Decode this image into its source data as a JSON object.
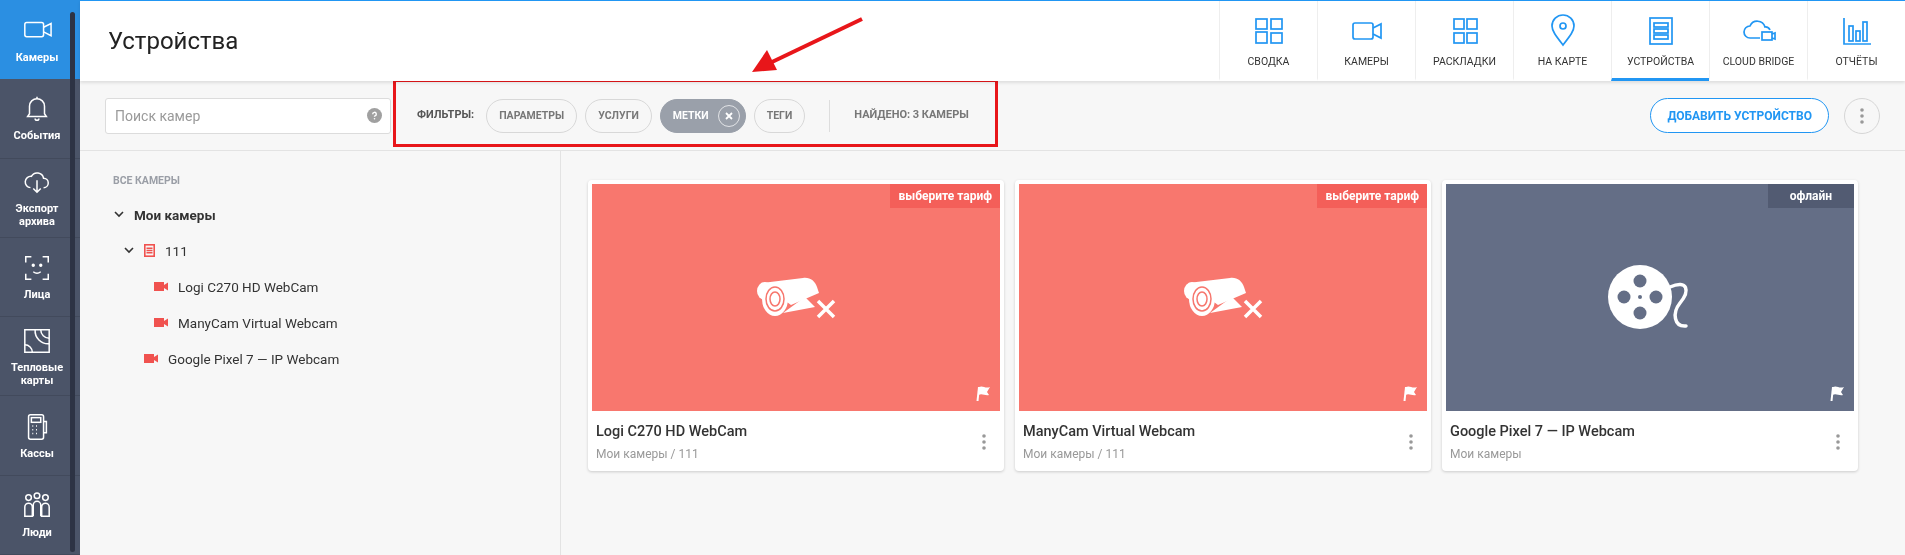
{
  "sidebar": {
    "items": [
      {
        "label": "Камеры",
        "selected": true
      },
      {
        "label": "События",
        "selected": false
      },
      {
        "label": "Экспорт архива",
        "selected": false
      },
      {
        "label": "Лица",
        "selected": false
      },
      {
        "label": "Тепловые карты",
        "selected": false
      },
      {
        "label": "Кассы",
        "selected": false
      },
      {
        "label": "Люди",
        "selected": false
      }
    ]
  },
  "header": {
    "title": "Устройства",
    "tabs": [
      {
        "label": "СВОДКА",
        "selected": false
      },
      {
        "label": "КАМЕРЫ",
        "selected": false
      },
      {
        "label": "РАСКЛАДКИ",
        "selected": false
      },
      {
        "label": "НА КАРТЕ",
        "selected": false
      },
      {
        "label": "УСТРОЙСТВА",
        "selected": true
      },
      {
        "label": "CLOUD BRIDGE",
        "selected": false
      },
      {
        "label": "ОТЧЁТЫ",
        "selected": false
      }
    ]
  },
  "toolbar": {
    "search": {
      "placeholder": "Поиск камер"
    },
    "filters_label": "ФИЛЬТРЫ:",
    "filters": [
      {
        "label": "ПАРАМЕТРЫ",
        "selected": false
      },
      {
        "label": "УСЛУГИ",
        "selected": false
      },
      {
        "label": "МЕТКИ",
        "selected": true
      },
      {
        "label": "ТЕГИ",
        "selected": false
      }
    ],
    "found": "НАЙДЕНО: 3 КАМЕРЫ",
    "add_button": "ДОБАВИТЬ УСТРОЙСТВО"
  },
  "annotation": {
    "highlight_box": true,
    "arrow": true
  },
  "tree": {
    "heading": "ВСЕ КАМЕРЫ",
    "items": [
      {
        "kind": "folder",
        "label": "Мои камеры",
        "expanded": true,
        "children": [
          {
            "kind": "group",
            "label": "111",
            "expanded": true,
            "children": [
              {
                "kind": "camera",
                "label": "Logi C270 HD WebCam"
              },
              {
                "kind": "camera",
                "label": "ManyCam Virtual Webcam"
              }
            ]
          },
          {
            "kind": "camera",
            "label": "Google Pixel 7 — IP Webcam"
          }
        ]
      }
    ]
  },
  "cards": [
    {
      "kind": "no_plan",
      "badge": "выберите тариф",
      "title": "Logi C270 HD WebCam",
      "path": "Мои камеры / 111"
    },
    {
      "kind": "no_plan",
      "badge": "выберите тариф",
      "title": "ManyCam Virtual Webcam",
      "path": "Мои камеры / 111"
    },
    {
      "kind": "offline",
      "badge": "офлайн",
      "title": "Google Pixel 7 — IP Webcam",
      "path": "Мои камеры"
    }
  ]
}
